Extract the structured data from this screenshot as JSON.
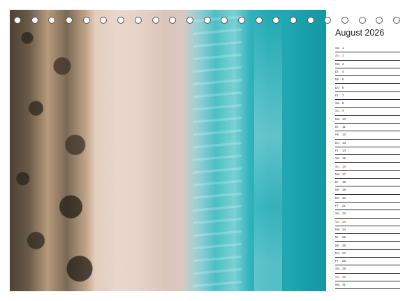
{
  "calendar": {
    "month_title": "August 2026",
    "days": [
      {
        "name": "Sa",
        "num": "1"
      },
      {
        "name": "So",
        "num": "2"
      },
      {
        "name": "Mo",
        "num": "3"
      },
      {
        "name": "Di",
        "num": "4"
      },
      {
        "name": "Mi",
        "num": "5"
      },
      {
        "name": "Do",
        "num": "6"
      },
      {
        "name": "Fr",
        "num": "7"
      },
      {
        "name": "Sa",
        "num": "8"
      },
      {
        "name": "So",
        "num": "9"
      },
      {
        "name": "Mo",
        "num": "10"
      },
      {
        "name": "Di",
        "num": "11"
      },
      {
        "name": "Mi",
        "num": "12"
      },
      {
        "name": "Do",
        "num": "13"
      },
      {
        "name": "Fr",
        "num": "14"
      },
      {
        "name": "Sa",
        "num": "15"
      },
      {
        "name": "So",
        "num": "16"
      },
      {
        "name": "Mo",
        "num": "17"
      },
      {
        "name": "Di",
        "num": "18"
      },
      {
        "name": "Mi",
        "num": "19"
      },
      {
        "name": "Do",
        "num": "20"
      },
      {
        "name": "Fr",
        "num": "21"
      },
      {
        "name": "Sa",
        "num": "22"
      },
      {
        "name": "So",
        "num": "23"
      },
      {
        "name": "Mo",
        "num": "24"
      },
      {
        "name": "Di",
        "num": "25"
      },
      {
        "name": "Mi",
        "num": "26"
      },
      {
        "name": "Do",
        "num": "27"
      },
      {
        "name": "Fr",
        "num": "28"
      },
      {
        "name": "Sa",
        "num": "29"
      },
      {
        "name": "So",
        "num": "30"
      },
      {
        "name": "Mo",
        "num": "31"
      }
    ],
    "sunday_color": "#c0392b",
    "text_color": "#333333"
  },
  "photo": {
    "subject": "",
    "colors": {
      "sand": "#e6d3c8",
      "sea": "#1fa8b2",
      "dunes": "#4e4234"
    }
  }
}
